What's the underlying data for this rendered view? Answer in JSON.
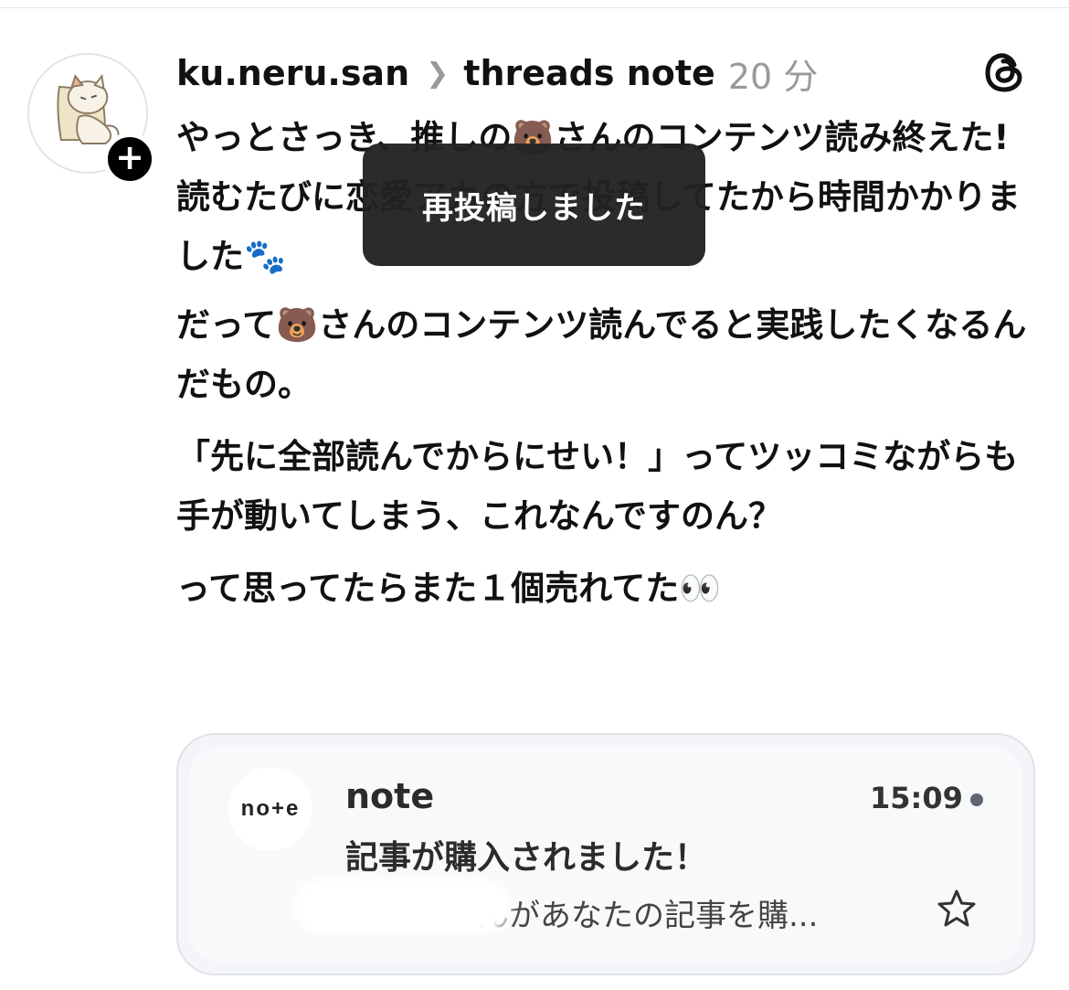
{
  "post": {
    "username": "ku.neru.san",
    "topic": "threads note",
    "time": "20 分",
    "paragraphs": [
      "やっとさっき、推しの🐻さんのコンテンツ読み終えた!\n読むたびに恋愛アカの方で投稿してたから時間かかりました🐾",
      "だって🐻さんのコンテンツ読んでると実践したくなるんだもの。",
      "「先に全部読んでからにせい！」ってツッコミながらも手が動いてしまう、これなんですのん？",
      "って思ってたらまた１個売れてた👀"
    ]
  },
  "toast": {
    "text": "再投稿しました"
  },
  "embedded_notification": {
    "logo_text": "no+e",
    "app_name": "note",
    "time": "15:09",
    "subject": "記事が購入されました！",
    "preview": "んがあなたの記事を購..."
  },
  "icons": {
    "follow": "plus-icon",
    "threads": "threads-logo-icon",
    "star": "star-icon",
    "chevron": "chevron-right-icon"
  }
}
